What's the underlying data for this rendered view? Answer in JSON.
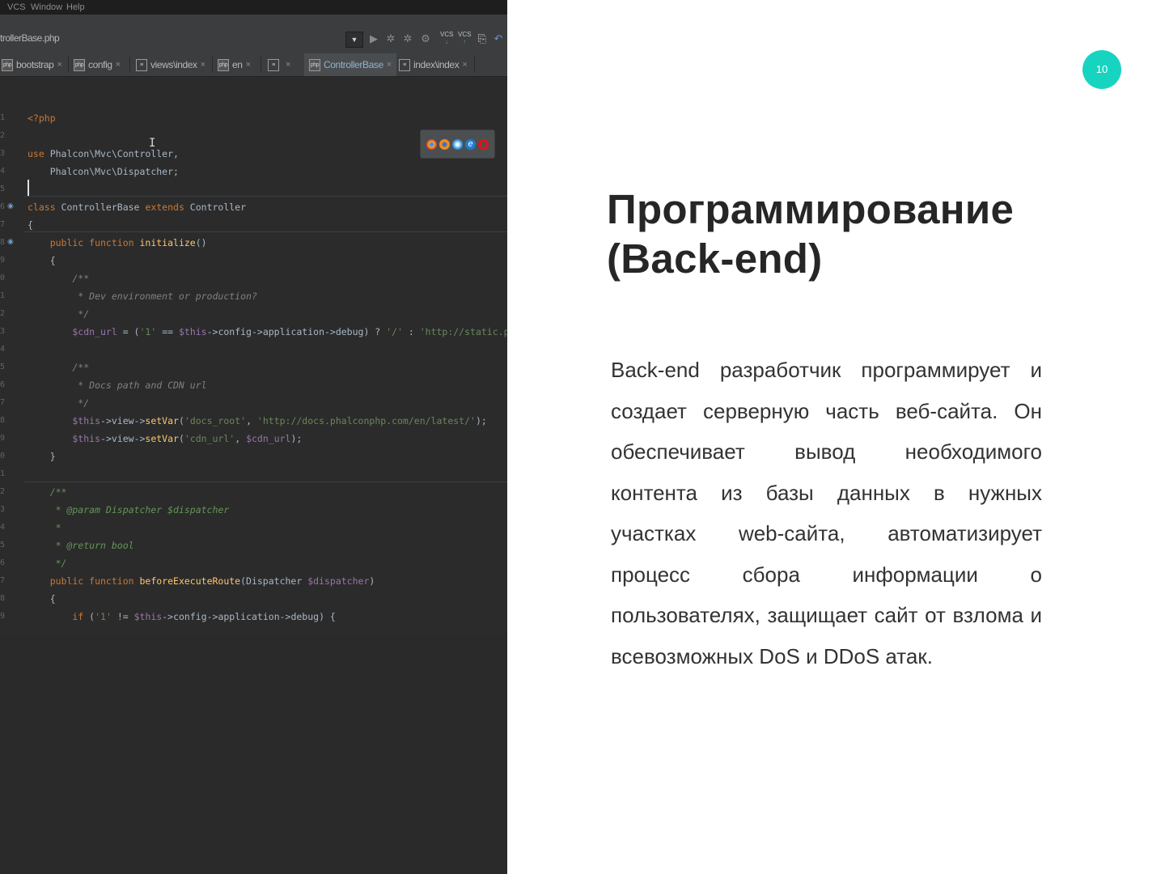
{
  "ide": {
    "menu": [
      "VCS",
      "Window",
      "Help"
    ],
    "file_crumb": "trollerBase.php",
    "dropdown_glyph": "▼",
    "toolbar": {
      "run_icon": "run-icon",
      "debug_icon": "debug-icon",
      "vcs_update_label": "VCS",
      "vcs_commit_label": "VCS",
      "undo_icon": "undo-icon"
    },
    "tabs": [
      {
        "label": "bootstrap",
        "icon": "php",
        "active": false
      },
      {
        "label": "config",
        "icon": "php",
        "active": false
      },
      {
        "label": "views\\index",
        "icon": "doc",
        "active": false
      },
      {
        "label": "en",
        "icon": "php",
        "active": false
      },
      {
        "label": "",
        "icon": "doc",
        "active": false
      },
      {
        "label": "ControllerBase",
        "icon": "php",
        "active": true
      },
      {
        "label": "index\\index",
        "icon": "doc",
        "active": false
      }
    ],
    "tab_close_glyph": "×",
    "browser_icons": [
      "chrome-icon",
      "firefox-icon",
      "safari-icon",
      "ie-icon",
      "opera-icon"
    ],
    "code": [
      {
        "ln": "1",
        "parts": [
          [
            "t-tag",
            "<?php"
          ]
        ]
      },
      {
        "ln": "2",
        "parts": []
      },
      {
        "ln": "3",
        "parts": [
          [
            "t-kw",
            "use "
          ],
          [
            "t-plain",
            "Phalcon\\Mvc\\Controller,"
          ]
        ]
      },
      {
        "ln": "4",
        "parts": [
          [
            "t-plain",
            "    Phalcon\\Mvc\\Dispatcher;"
          ]
        ]
      },
      {
        "ln": "5",
        "parts": []
      },
      {
        "ln": "6",
        "parts": [
          [
            "t-kw",
            "class "
          ],
          [
            "t-plain",
            "ControllerBase "
          ],
          [
            "t-kw",
            "extends "
          ],
          [
            "t-plain",
            "Controller"
          ]
        ]
      },
      {
        "ln": "7",
        "parts": [
          [
            "t-plain",
            "{"
          ]
        ]
      },
      {
        "ln": "8",
        "parts": [
          [
            "t-kw",
            "    public function "
          ],
          [
            "t-fn",
            "initialize"
          ],
          [
            "t-plain",
            "()"
          ]
        ]
      },
      {
        "ln": "9",
        "parts": [
          [
            "t-plain",
            "    {"
          ]
        ]
      },
      {
        "ln": "0",
        "parts": [
          [
            "t-cm",
            "        /**"
          ]
        ]
      },
      {
        "ln": "1",
        "parts": [
          [
            "t-cm",
            "         * Dev environment or production?"
          ]
        ]
      },
      {
        "ln": "2",
        "parts": [
          [
            "t-cm",
            "         */"
          ]
        ]
      },
      {
        "ln": "3",
        "parts": [
          [
            "t-var",
            "        $cdn_url"
          ],
          [
            "t-plain",
            " = ("
          ],
          [
            "t-str",
            "'1'"
          ],
          [
            "t-plain",
            " == "
          ],
          [
            "t-var",
            "$this"
          ],
          [
            "t-plain",
            "->config->application->debug) ? "
          ],
          [
            "t-str",
            "'/'"
          ],
          [
            "t-plain",
            " : "
          ],
          [
            "t-str",
            "'http://static.phalconphp.com"
          ]
        ]
      },
      {
        "ln": "4",
        "parts": []
      },
      {
        "ln": "5",
        "parts": [
          [
            "t-cm",
            "        /**"
          ]
        ]
      },
      {
        "ln": "6",
        "parts": [
          [
            "t-cm",
            "         * Docs path and CDN url"
          ]
        ]
      },
      {
        "ln": "7",
        "parts": [
          [
            "t-cm",
            "         */"
          ]
        ]
      },
      {
        "ln": "8",
        "parts": [
          [
            "t-var",
            "        $this"
          ],
          [
            "t-plain",
            "->view->"
          ],
          [
            "t-fn",
            "setVar"
          ],
          [
            "t-plain",
            "("
          ],
          [
            "t-str",
            "'docs_root'"
          ],
          [
            "t-plain",
            ", "
          ],
          [
            "t-str",
            "'http://docs.phalconphp.com/en/latest/'"
          ],
          [
            "t-plain",
            ");"
          ]
        ]
      },
      {
        "ln": "9",
        "parts": [
          [
            "t-var",
            "        $this"
          ],
          [
            "t-plain",
            "->view->"
          ],
          [
            "t-fn",
            "setVar"
          ],
          [
            "t-plain",
            "("
          ],
          [
            "t-str",
            "'cdn_url'"
          ],
          [
            "t-plain",
            ", "
          ],
          [
            "t-var",
            "$cdn_url"
          ],
          [
            "t-plain",
            ");"
          ]
        ]
      },
      {
        "ln": "0",
        "parts": [
          [
            "t-plain",
            "    }"
          ]
        ]
      },
      {
        "ln": "1",
        "parts": []
      },
      {
        "ln": "2",
        "parts": [
          [
            "t-doc",
            "    /**"
          ]
        ]
      },
      {
        "ln": "3",
        "parts": [
          [
            "t-doc",
            "     * @param Dispatcher $dispatcher"
          ]
        ]
      },
      {
        "ln": "4",
        "parts": [
          [
            "t-doc",
            "     *"
          ]
        ]
      },
      {
        "ln": "5",
        "parts": [
          [
            "t-doc",
            "     * @return bool"
          ]
        ]
      },
      {
        "ln": "6",
        "parts": [
          [
            "t-doc",
            "     */"
          ]
        ]
      },
      {
        "ln": "7",
        "parts": [
          [
            "t-kw",
            "    public function "
          ],
          [
            "t-fn",
            "beforeExecuteRoute"
          ],
          [
            "t-plain",
            "(Dispatcher "
          ],
          [
            "t-var",
            "$dispatcher"
          ],
          [
            "t-plain",
            ")"
          ]
        ]
      },
      {
        "ln": "8",
        "parts": [
          [
            "t-plain",
            "    {"
          ]
        ]
      },
      {
        "ln": "9",
        "parts": [
          [
            "t-kw",
            "        if "
          ],
          [
            "t-plain",
            "("
          ],
          [
            "t-str",
            "'1'"
          ],
          [
            "t-plain",
            " != "
          ],
          [
            "t-var",
            "$this"
          ],
          [
            "t-plain",
            "->config->application->debug) {"
          ]
        ]
      }
    ]
  },
  "slide": {
    "page_number": "10",
    "title": "Программирование (Back-end)",
    "body": "Back-end разработчик   программирует и создает серверную часть веб-сайта. Он обеспечивает вывод необходимого контента из базы данных в нужных участках web-сайта, автоматизирует процесс сбора информации о пользователях, защищает сайт от взлома и всевозможных DoS и DDoS атак.",
    "accent_color": "#17d4c1"
  }
}
